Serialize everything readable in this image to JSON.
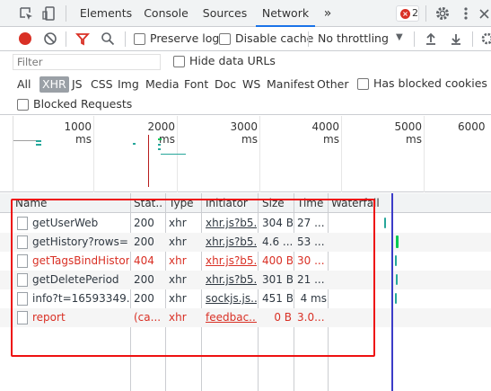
{
  "tabs": {
    "items": [
      "Elements",
      "Console",
      "Sources",
      "Network"
    ],
    "active": "Network",
    "more": "»",
    "error_count": "2"
  },
  "toolbar": {
    "preserve_log": "Preserve log",
    "disable_cache": "Disable cache",
    "throttling": "No throttling"
  },
  "filter": {
    "placeholder": "Filter",
    "hide_data_urls": "Hide data URLs"
  },
  "type_filters": {
    "items": [
      "All",
      "XHR",
      "JS",
      "CSS",
      "Img",
      "Media",
      "Font",
      "Doc",
      "WS",
      "Manifest",
      "Other"
    ],
    "selected": "XHR",
    "has_blocked_cookies": "Has blocked cookies",
    "blocked_requests": "Blocked Requests"
  },
  "overview": {
    "ticks": [
      "1000 ms",
      "2000 ms",
      "3000 ms",
      "4000 ms",
      "5000 ms",
      "6000"
    ]
  },
  "table": {
    "columns": [
      "Name",
      "Stat...",
      "Type",
      "Initiator",
      "Size",
      "Time",
      "Waterfall"
    ],
    "rows": [
      {
        "name": "getUserWeb",
        "status": "200",
        "type": "xhr",
        "initiator": "xhr.js?b5...",
        "size": "304 B",
        "time": "27 ...",
        "error": false
      },
      {
        "name": "getHistory?rows=...",
        "status": "200",
        "type": "xhr",
        "initiator": "xhr.js?b5...",
        "size": "4.6 ...",
        "time": "53 ...",
        "error": false
      },
      {
        "name": "getTagsBindHistory",
        "status": "404",
        "type": "xhr",
        "initiator": "xhr.js?b5...",
        "size": "400 B",
        "time": "30 ...",
        "error": true
      },
      {
        "name": "getDeletePeriod",
        "status": "200",
        "type": "xhr",
        "initiator": "xhr.js?b5...",
        "size": "301 B",
        "time": "21 ...",
        "error": false
      },
      {
        "name": "info?t=16593349...",
        "status": "200",
        "type": "xhr",
        "initiator": "sockjs.js...",
        "size": "451 B",
        "time": "4 ms",
        "error": false
      },
      {
        "name": "report",
        "status": "(ca...",
        "type": "xhr",
        "initiator": "feedbac...",
        "size": "0 B",
        "time": "3.0...",
        "error": true
      }
    ]
  },
  "colors": {
    "accent_blue": "#1a73e8",
    "error_red": "#d93025",
    "highlight_box": "#ee1111",
    "waterfall_green": "#00c853",
    "waterfall_teal": "#26a69a"
  }
}
